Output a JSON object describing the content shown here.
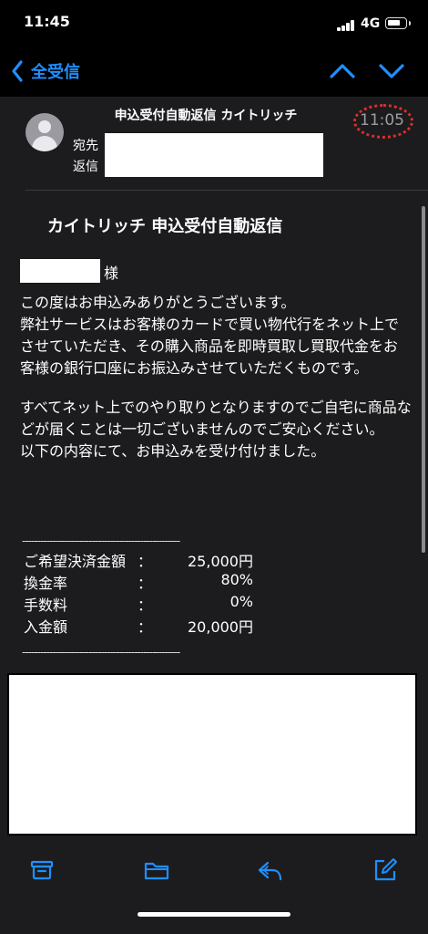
{
  "status_bar": {
    "time": "11:45",
    "network": "4G"
  },
  "nav": {
    "back_label": "全受信",
    "back_icon": "chevron-left-icon",
    "up_icon": "chevron-up-icon",
    "down_icon": "chevron-down-icon"
  },
  "message": {
    "subject": "申込受付自動返信 カイトリッチ",
    "time": "11:05",
    "to_label": "宛先",
    "reply_label": "返信",
    "headline": "カイトリッチ 申込受付自動返信",
    "honorific": "様",
    "paragraphs": [
      "この度はお申込みありがとうございます。\n弊社サービスはお客様のカードで買い物代行をネット上でさせていただき、その購入商品を即時買取し買取代金をお客様の銀行口座にお振込みさせていただくものです。",
      "すべてネット上でのやり取りとなりますのでご自宅に商品などが届くことは一切ございませんのでご安心ください。\n以下の内容にて、お申込みを受け付けました。"
    ],
    "separator": "----------------------------------------------------",
    "payment": [
      {
        "label": "ご希望決済金額",
        "colon": "：",
        "value": "25,000円"
      },
      {
        "label": "換金率",
        "colon": "：",
        "value": "80%"
      },
      {
        "label": "手数料",
        "colon": "：",
        "value": "0%"
      },
      {
        "label": "入金額",
        "colon": "：",
        "value": "20,000円"
      }
    ]
  },
  "toolbar": {
    "archive_icon": "archive-icon",
    "folder_icon": "folder-icon",
    "reply_icon": "reply-icon",
    "compose_icon": "compose-icon"
  },
  "colors": {
    "accent": "#1f8fff",
    "background": "#1c1c1e",
    "highlight_circle": "#d9302b"
  }
}
